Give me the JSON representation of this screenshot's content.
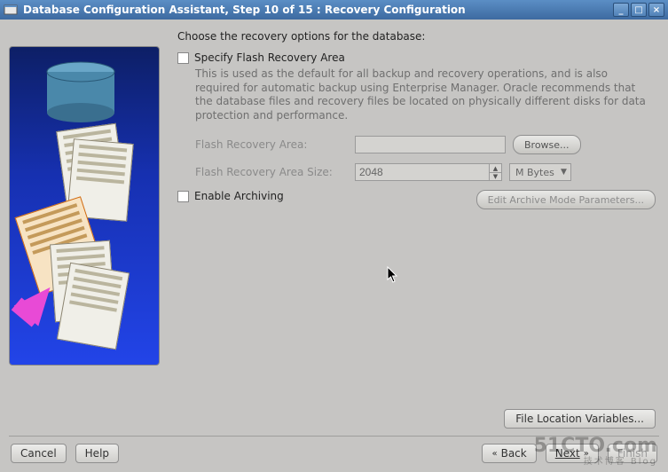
{
  "window": {
    "title": "Database Configuration Assistant, Step 10 of 15 : Recovery Configuration"
  },
  "intro": "Choose the recovery options for the database:",
  "flash": {
    "checkbox_label": "Specify Flash Recovery Area",
    "description": "This is used as the default for all backup and recovery operations, and is also required for automatic backup using Enterprise Manager. Oracle recommends that the database files and recovery files be located on physically different disks for data protection and performance.",
    "area_label": "Flash Recovery Area:",
    "area_value": "",
    "browse_label": "Browse...",
    "size_label": "Flash Recovery Area Size:",
    "size_value": "2048",
    "size_unit": "M Bytes"
  },
  "archive": {
    "checkbox_label": "Enable Archiving",
    "edit_button": "Edit Archive Mode Parameters..."
  },
  "file_loc_button": "File Location Variables...",
  "footer": {
    "cancel": "Cancel",
    "help": "Help",
    "back": "Back",
    "next": "Next",
    "finish": "Finish"
  },
  "watermark": {
    "main": "51CTO.com",
    "sub": "技术博客   Blog"
  }
}
